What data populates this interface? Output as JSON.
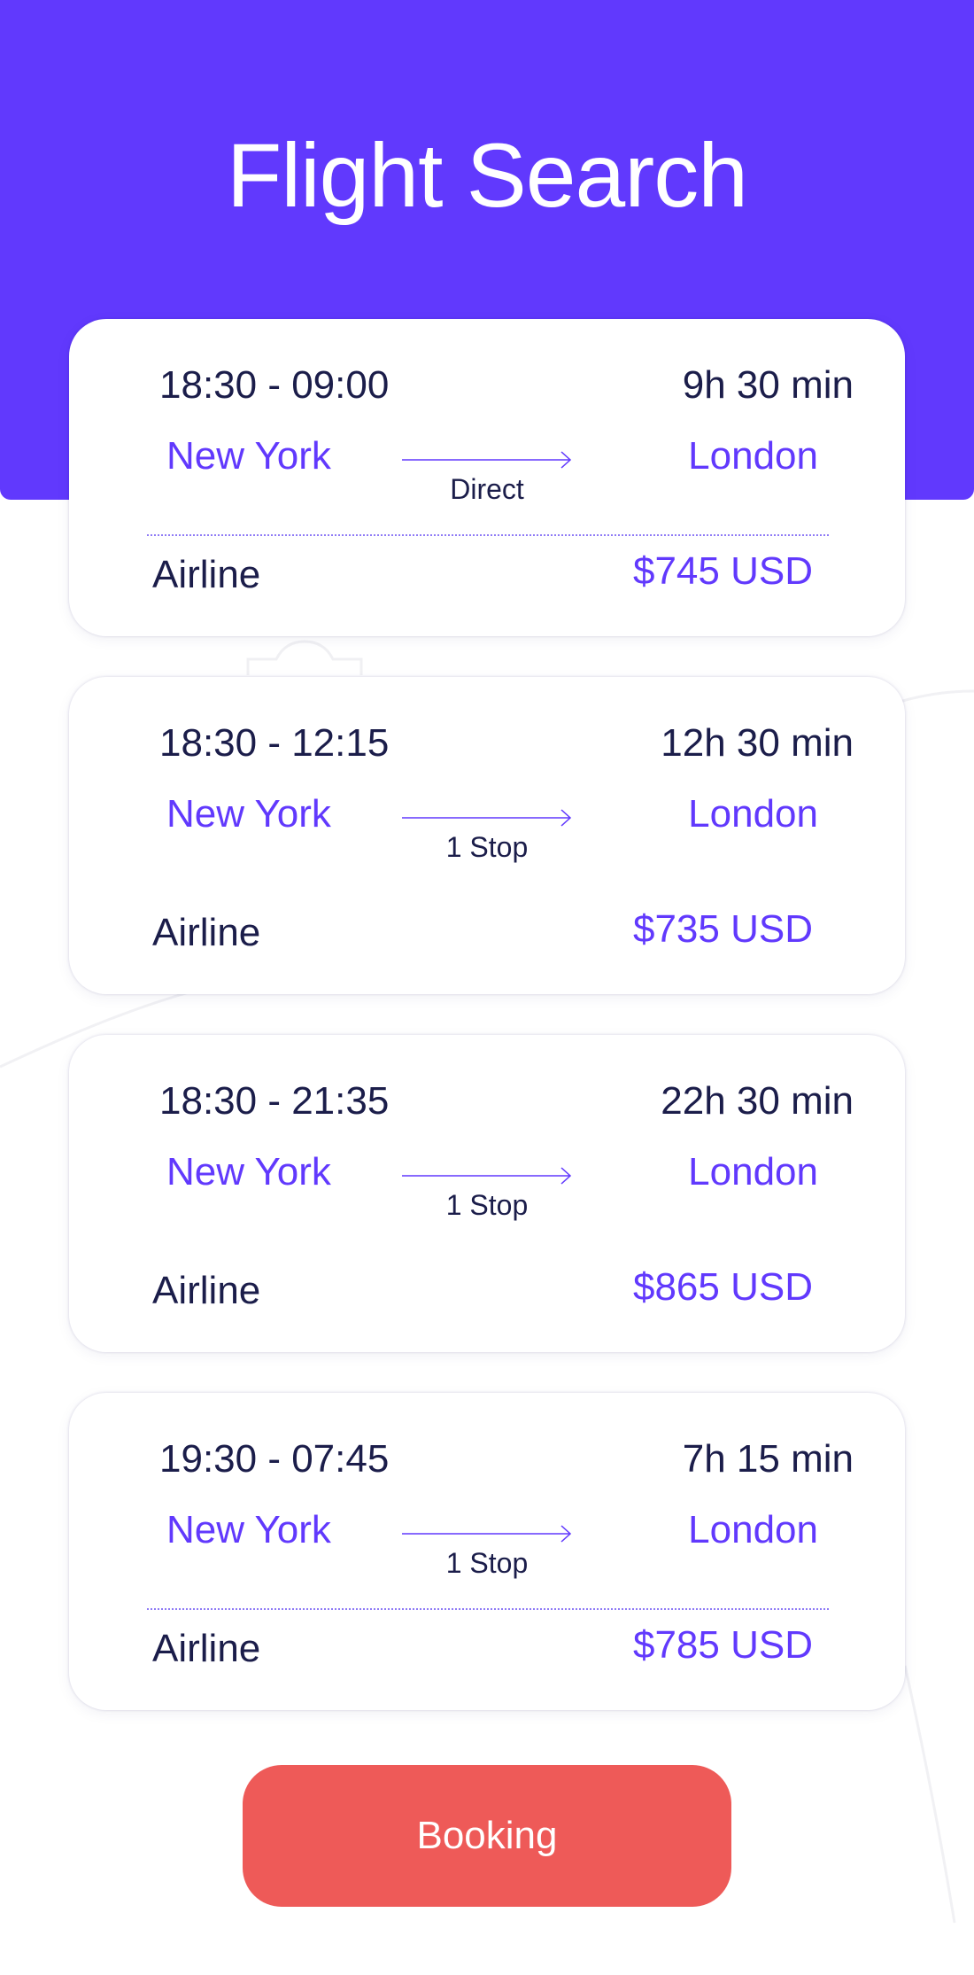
{
  "header": {
    "title": "Flight Search"
  },
  "flights": [
    {
      "times": "18:30 - 09:00",
      "duration": "9h 30 min",
      "origin": "New York",
      "destination": "London",
      "stops": "Direct",
      "airline": "Airline",
      "price": "$745 USD",
      "show_divider": true
    },
    {
      "times": "18:30 - 12:15",
      "duration": "12h 30 min",
      "origin": "New York",
      "destination": "London",
      "stops": "1 Stop",
      "airline": "Airline",
      "price": "$735 USD",
      "show_divider": false
    },
    {
      "times": "18:30 - 21:35",
      "duration": "22h 30 min",
      "origin": "New York",
      "destination": "London",
      "stops": "1 Stop",
      "airline": "Airline",
      "price": "$865 USD",
      "show_divider": false
    },
    {
      "times": "19:30 - 07:45",
      "duration": "7h 15 min",
      "origin": "New York",
      "destination": "London",
      "stops": "1 Stop",
      "airline": "Airline",
      "price": "$785 USD",
      "show_divider": true
    }
  ],
  "booking_button": {
    "label": "Booking"
  },
  "colors": {
    "primary": "#6139fd",
    "text_dark": "#1b1d4a",
    "booking": "#ee5a58",
    "background": "#ffffff"
  }
}
